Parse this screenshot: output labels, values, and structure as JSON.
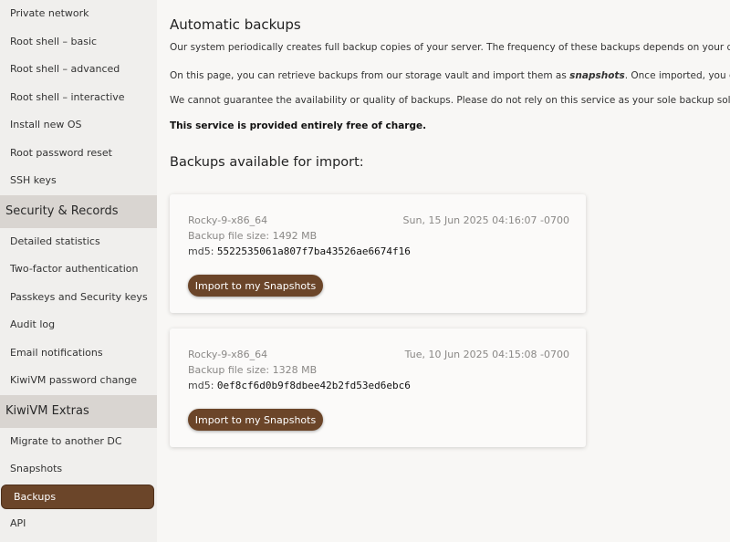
{
  "sidebar": {
    "group1_items": [
      {
        "label": "Private network"
      },
      {
        "label": "Root shell – basic"
      },
      {
        "label": "Root shell – advanced"
      },
      {
        "label": "Root shell – interactive"
      },
      {
        "label": "Install new OS"
      },
      {
        "label": "Root password reset"
      },
      {
        "label": "SSH keys"
      }
    ],
    "section2": "Security & Records",
    "group2_items": [
      {
        "label": "Detailed statistics"
      },
      {
        "label": "Two-factor authentication"
      },
      {
        "label": "Passkeys and Security keys"
      },
      {
        "label": "Audit log"
      },
      {
        "label": "Email notifications"
      },
      {
        "label": "KiwiVM password change"
      }
    ],
    "section3": "KiwiVM Extras",
    "group3_items": [
      {
        "label": "Migrate to another DC"
      },
      {
        "label": "Snapshots"
      },
      {
        "label": "Backups",
        "active": true
      },
      {
        "label": "API"
      }
    ]
  },
  "main": {
    "title": "Automatic backups",
    "paragraphs": [
      "Our system periodically creates full backup copies of your server. The frequency of these backups depends on your disk usage: th",
      "We cannot guarantee the availability or quality of backups. Please do not rely on this service as your sole backup solution. Use at"
    ],
    "p2_before": "On this page, you can retrieve backups from our storage vault and import them as ",
    "p2_em": "snapshots",
    "p2_after": ". Once imported, you can use these s",
    "free_note": "This service is provided entirely free of charge.",
    "backups_heading": "Backups available for import:",
    "md5_label": "md5:",
    "import_button_label": "Import to my Snapshots",
    "backups": [
      {
        "name": "Rocky-9-x86_64",
        "date": "Sun, 15 Jun 2025 04:16:07 -0700",
        "size": "Backup file size: 1492 MB",
        "md5": "5522535061a807f7ba43526ae6674f16"
      },
      {
        "name": "Rocky-9-x86_64",
        "date": "Tue, 10 Jun 2025 04:15:08 -0700",
        "size": "Backup file size: 1328 MB",
        "md5": "0ef8cf6d0b9f8dbee42b2fd53ed6ebc6"
      }
    ]
  },
  "colors": {
    "accent": "#6b4529",
    "section_header_bg": "#d9d5d1",
    "sidebar_bg": "#f0efed",
    "main_bg": "#f8f7f5"
  }
}
